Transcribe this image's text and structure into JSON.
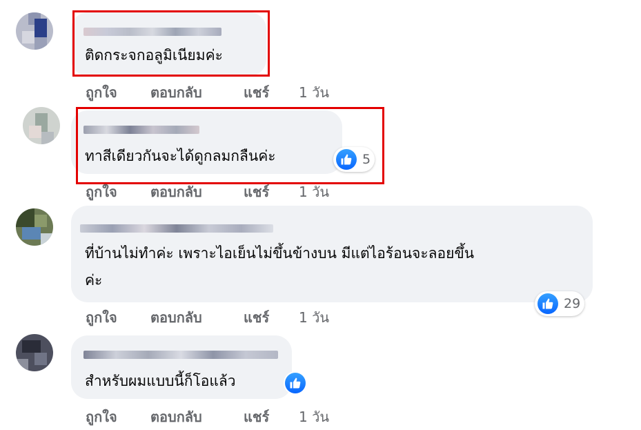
{
  "comments": [
    {
      "text": "ติดกระจกอลูมิเนียมค่ะ",
      "actions": {
        "like": "ถูกใจ",
        "reply": "ตอบกลับ",
        "share": "แชร์",
        "time": "1 วัน"
      }
    },
    {
      "text": "ทาสีเดียวกันจะได้ดูกลมกลืนค่ะ",
      "reactions": "5",
      "actions": {
        "like": "ถูกใจ",
        "reply": "ตอบกลับ",
        "share": "แชร์",
        "time": "1 วัน"
      }
    },
    {
      "text_line1": "ที่บ้านไม่ทำค่ะ เพราะไอเย็นไม่ขึ้นข้างบน มีแต่ไอร้อนจะลอยขึ้น",
      "text_line2": "ค่ะ",
      "reactions": "29",
      "actions": {
        "like": "ถูกใจ",
        "reply": "ตอบกลับ",
        "share": "แชร์",
        "time": "1 วัน"
      }
    },
    {
      "text": "สำหรับผมแบบนี้ก็โอแล้ว",
      "actions": {
        "like": "ถูกใจ",
        "reply": "ตอบกลับ",
        "share": "แชร์",
        "time": "1 วัน"
      }
    }
  ],
  "colors": {
    "bubble": "#f0f2f5",
    "muted": "#65676b",
    "like_blue": "#0866ff",
    "highlight": "#e30000"
  },
  "icons": {
    "reaction": "thumbs-up-icon"
  }
}
